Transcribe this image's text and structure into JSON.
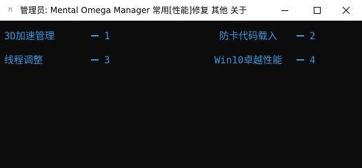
{
  "window": {
    "app_icon": "M",
    "title": "管理员:  Mental Omega Manager 常用[性能]修复 其他 关于"
  },
  "menu_items": [
    {
      "label": "3D加速管理",
      "key": "1"
    },
    {
      "label": "防卡代码载入",
      "key": "2"
    },
    {
      "label": "线程调整",
      "key": "3"
    },
    {
      "label": "Win10卓越性能",
      "key": "4"
    }
  ],
  "colors": {
    "console_background": "#0c0c0c",
    "console_text": "#3a96dd",
    "titlebar_background": "#ffffff"
  }
}
